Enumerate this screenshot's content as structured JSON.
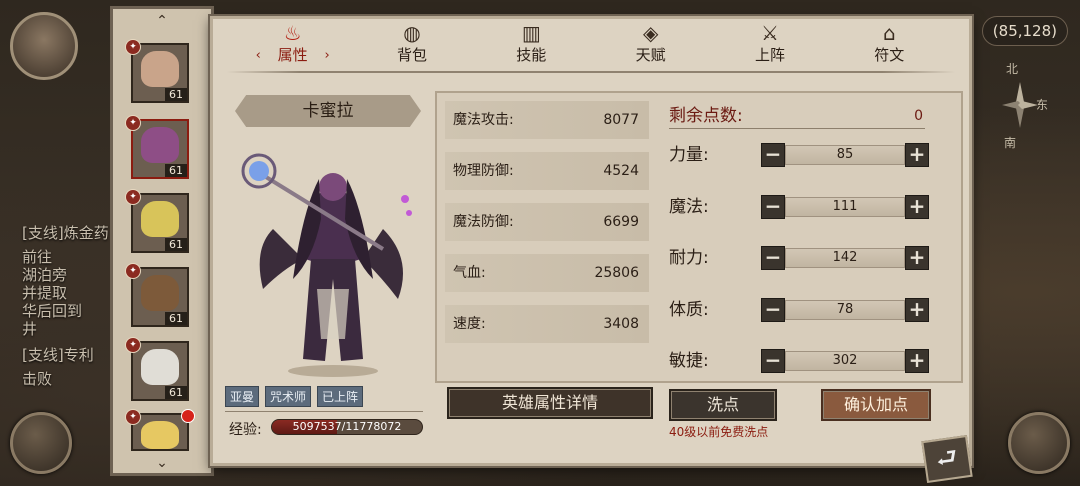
{
  "world": {
    "coords": "(85,128)",
    "compass": {
      "north": "北",
      "east": "东",
      "south": "南"
    },
    "quest_lines": [
      "[支线]炼金药",
      "前往",
      "湖泊旁",
      "并提取",
      "华后回到",
      "井",
      "[支线]专利",
      "击败"
    ]
  },
  "tabs": [
    {
      "label": "属性",
      "icon": "flame-icon",
      "active": true
    },
    {
      "label": "背包",
      "icon": "bag-icon",
      "active": false
    },
    {
      "label": "技能",
      "icon": "book-icon",
      "active": false
    },
    {
      "label": "天赋",
      "icon": "eye-icon",
      "active": false
    },
    {
      "label": "上阵",
      "icon": "crossed-swords-icon",
      "active": false
    },
    {
      "label": "符文",
      "icon": "rune-icon",
      "active": false
    }
  ],
  "hero": {
    "name": "卡蜜拉",
    "tags": [
      "亚曼",
      "咒术师",
      "已上阵"
    ],
    "exp_label": "经验:",
    "exp_text": "5097537/11778072",
    "exp_fraction": 0.433
  },
  "stats": [
    {
      "label": "魔法攻击:",
      "value": "8077"
    },
    {
      "label": "物理防御:",
      "value": "4524"
    },
    {
      "label": "魔法防御:",
      "value": "6699"
    },
    {
      "label": "气血:",
      "value": "25806"
    },
    {
      "label": "速度:",
      "value": "3408"
    }
  ],
  "points": {
    "label": "剩余点数:",
    "value": "0"
  },
  "allocations": [
    {
      "label": "力量:",
      "value": "85"
    },
    {
      "label": "魔法:",
      "value": "111"
    },
    {
      "label": "耐力:",
      "value": "142"
    },
    {
      "label": "体质:",
      "value": "78"
    },
    {
      "label": "敏捷:",
      "value": "302"
    }
  ],
  "buttons": {
    "detail": "英雄属性详情",
    "reset": "洗点",
    "confirm": "确认加点",
    "reset_note": "40级以前免费洗点",
    "minus": "−",
    "plus": "+"
  },
  "hero_list": [
    {
      "level": "61",
      "selected": false,
      "face": "#c9a48a"
    },
    {
      "level": "61",
      "selected": true,
      "face": "#8e4e86"
    },
    {
      "level": "61",
      "selected": false,
      "face": "#d8c45a"
    },
    {
      "level": "61",
      "selected": false,
      "face": "#7d5a3a"
    },
    {
      "level": "61",
      "selected": false,
      "face": "#e0ddd6"
    },
    {
      "level": "",
      "selected": false,
      "face": "#e6c862",
      "alert": true
    }
  ],
  "colors": {
    "accent": "#8b1c10",
    "panel": "#ddd3c2",
    "exp_fill": "#8a2a22"
  }
}
